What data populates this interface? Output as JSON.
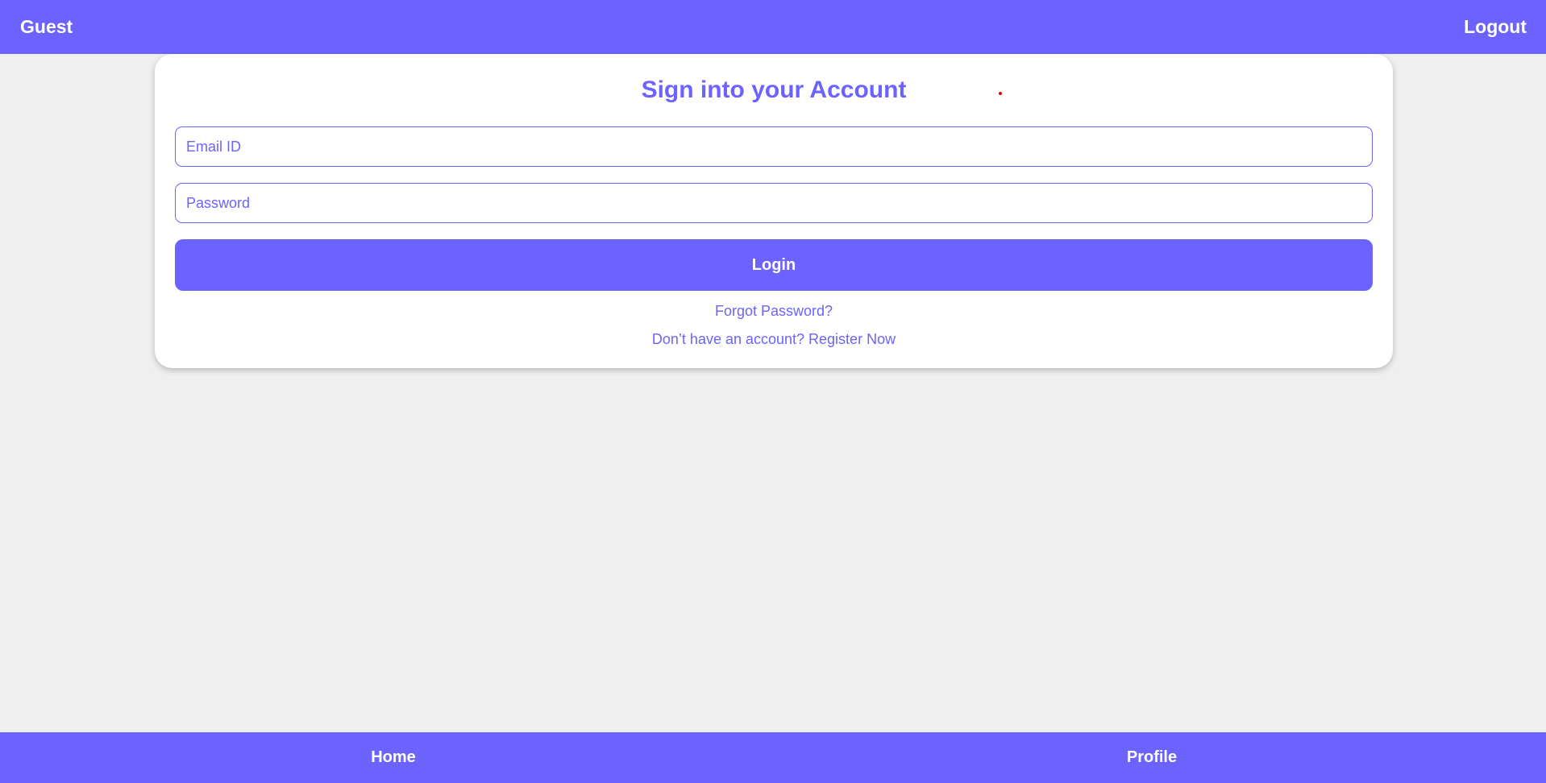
{
  "header": {
    "user_label": "Guest",
    "logout_label": "Logout"
  },
  "login_card": {
    "title": "Sign into your Account",
    "email_placeholder": "Email ID",
    "email_value": "",
    "password_placeholder": "Password",
    "password_value": "",
    "login_label": "Login",
    "forgot_label": "Forgot Password?",
    "register_label": "Don’t have an account? Register Now"
  },
  "bottom_nav": {
    "items": [
      {
        "label": "Home"
      },
      {
        "label": "Profile"
      }
    ]
  },
  "colors": {
    "accent": "#6c63ff",
    "background": "#efefef",
    "card": "#ffffff",
    "marker": "#e00000"
  }
}
